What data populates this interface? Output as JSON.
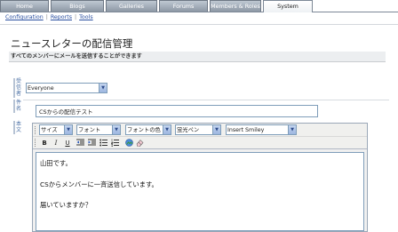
{
  "tabs": [
    {
      "label": "Home",
      "active": false
    },
    {
      "label": "Blogs",
      "active": false
    },
    {
      "label": "Galleries",
      "active": false
    },
    {
      "label": "Forums",
      "active": false
    },
    {
      "label": "Members & Roles",
      "active": false
    },
    {
      "label": "System",
      "active": true
    }
  ],
  "subnav": {
    "items": [
      "Configuration",
      "Reports",
      "Tools"
    ],
    "separator": "|"
  },
  "page": {
    "title": "ニュースレターの配信管理",
    "description": "すべてのメンバーにメールを送信することができます"
  },
  "form": {
    "recipient_label": "受信者",
    "recipient_value": "Everyone",
    "subject_label": "件名",
    "subject_value": "CSからの配信テスト",
    "body_label": "本文"
  },
  "editor": {
    "dropdowns": {
      "size": "サイズ",
      "font": "フォント",
      "font_color": "フォントの色",
      "highlighter": "蛍光ペン",
      "smiley": "Insert Smiley"
    },
    "buttons": {
      "bold": "B",
      "italic": "I",
      "underline": "U"
    },
    "content_lines": [
      "山田です。",
      "CSからメンバーに一斉送信しています。",
      "届いていますか？"
    ]
  },
  "colors": {
    "tab_inactive": "#8d98a5",
    "tab_active": "#ffffff",
    "link": "#2a4fa0",
    "accent_label": "#4a6fa5"
  }
}
